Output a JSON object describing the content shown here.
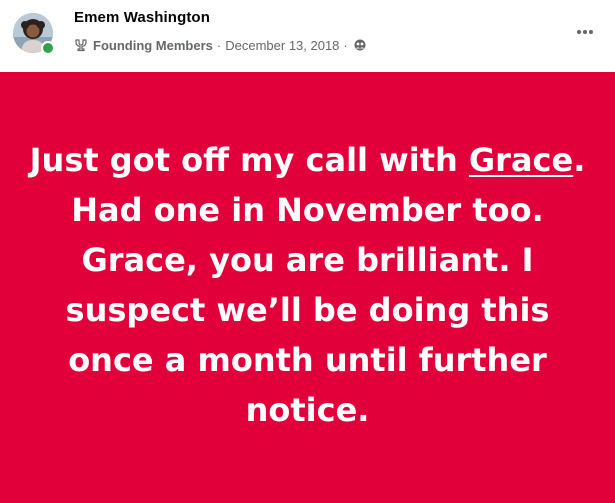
{
  "post": {
    "author": {
      "name": "Emem Washington",
      "online": true
    },
    "group_badge_icon": "founding-member-badge-icon",
    "group": "Founding Members",
    "separator": "·",
    "date": "December 13, 2018",
    "audience_icon": "members-audience-icon",
    "more_icon": "more-options-icon",
    "background_color": "#e2003a",
    "text": {
      "before_mention": "Just got off my call with ",
      "mention": "Grace",
      "after_mention": ". Had one in November too. Grace, you are brilliant. I suspect we’ll be doing this once a month until further notice."
    }
  }
}
